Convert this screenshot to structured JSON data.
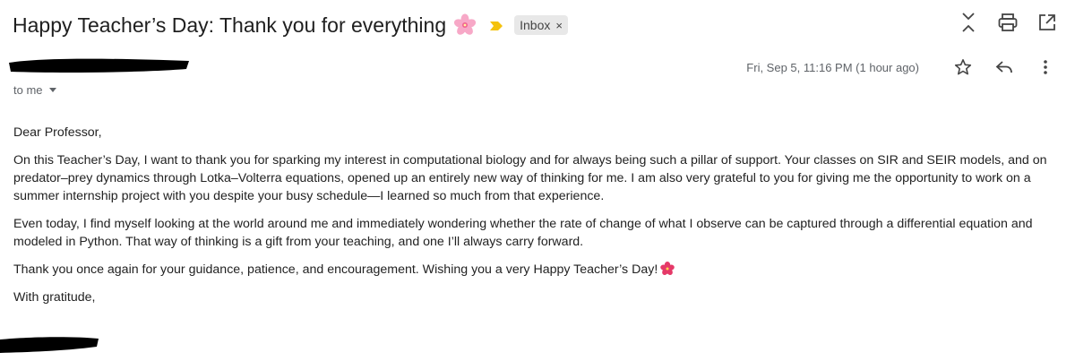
{
  "email": {
    "subject": "Happy Teacher’s Day: Thank you for everything",
    "label": "Inbox",
    "label_close": "×",
    "recipient": "to me",
    "date": "Fri, Sep 5, 11:16 PM (1 hour ago)",
    "body": {
      "greeting": "Dear Professor,",
      "para1": "On this Teacher’s Day, I want to thank you for sparking my interest in computational biology and for always being such a pillar of support. Your classes on SIR and SEIR models, and on predator–prey dynamics through Lotka–Volterra equations, opened up an entirely new way of thinking for me. I am also very grateful to you for giving me the opportunity to work on a summer internship project with you despite your busy schedule—I learned so much from that experience.",
      "para2": "Even today, I find myself looking at the world around me and immediately wondering whether the rate of change of what I observe can be captured through a differential equation and modeled in Python. That way of thinking is a gift from your teaching, and one I’ll always carry forward.",
      "para3": "Thank you once again for your guidance, patience, and encouragement. Wishing you a very Happy Teacher’s Day!",
      "closing": "With gratitude,"
    }
  },
  "icons": {
    "subject_emoji": "cherry-blossom-icon",
    "importance": "importance-marker-icon",
    "top_actions": [
      "expand-collapse-icon",
      "print-icon",
      "open-in-new-window-icon"
    ],
    "meta_actions": [
      "star-icon",
      "reply-icon",
      "more-vert-icon"
    ],
    "body_emoji": "hibiscus-icon"
  },
  "colors": {
    "importance": "#f4c20d",
    "chip_bg": "#e8e8e8",
    "meta_text": "#5f6368",
    "body_text": "#222222"
  }
}
